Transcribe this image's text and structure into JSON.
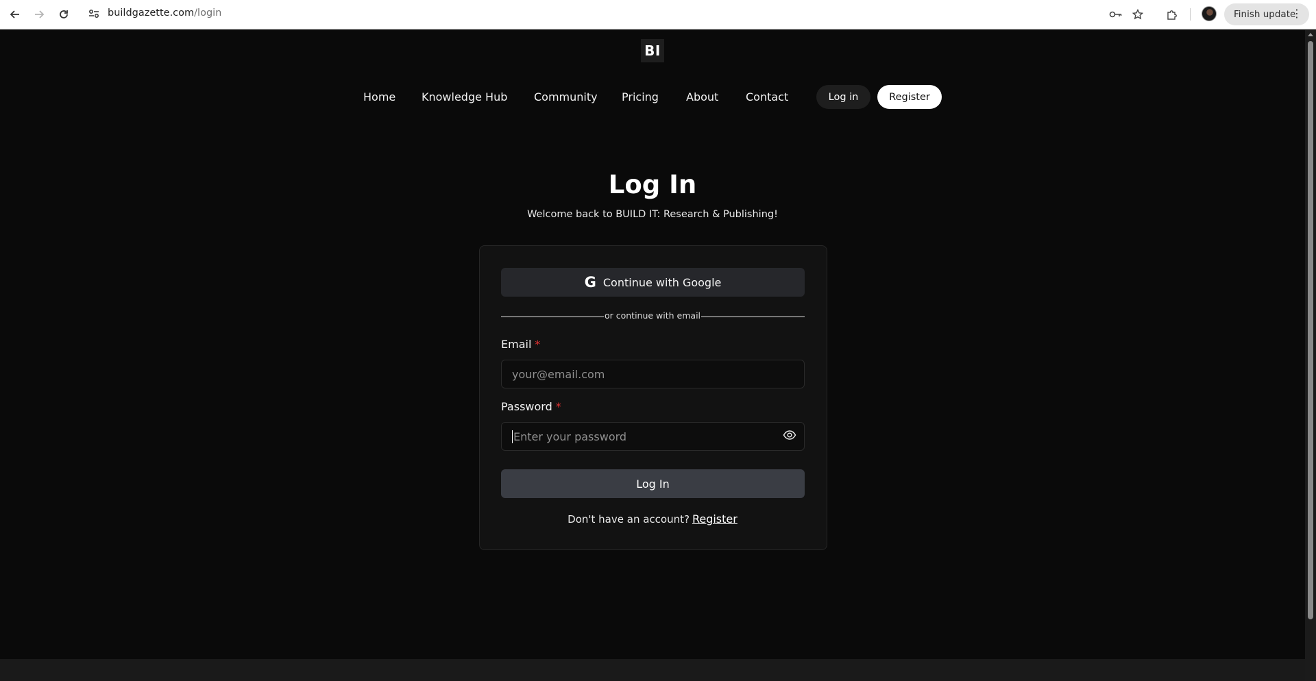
{
  "browser": {
    "url_domain": "buildgazette.com",
    "url_path": "/login",
    "finish_update_label": "Finish update",
    "icons": {
      "back": "back-arrow-icon",
      "forward": "forward-arrow-icon",
      "reload": "reload-icon",
      "site_info": "site-info-icon",
      "password_key": "key-icon",
      "bookmark": "star-icon",
      "extensions": "puzzle-icon",
      "menu": "more-vert-icon"
    }
  },
  "header": {
    "logo_text": "BI",
    "nav": [
      {
        "label": "Home"
      },
      {
        "label": "Knowledge Hub"
      },
      {
        "label": "Community"
      },
      {
        "label": "Pricing"
      },
      {
        "label": "About"
      },
      {
        "label": "Contact"
      }
    ],
    "login_label": "Log in",
    "register_label": "Register"
  },
  "main": {
    "title": "Log In",
    "subtitle": "Welcome back to BUILD IT: Research & Publishing!"
  },
  "form": {
    "google_label": "Continue with Google",
    "google_icon": "G",
    "divider_text": "or continue with email",
    "email_label": "Email",
    "email_placeholder": "your@email.com",
    "password_label": "Password",
    "password_placeholder": "Enter your password",
    "required_mark": "*",
    "submit_label": "Log In",
    "signup_prompt": "Don't have an account?",
    "signup_link": "Register"
  },
  "colors": {
    "page_bg": "#0a0a0a",
    "card_bg": "#121212",
    "button_bg": "#3a3d44",
    "required": "#e03131"
  }
}
